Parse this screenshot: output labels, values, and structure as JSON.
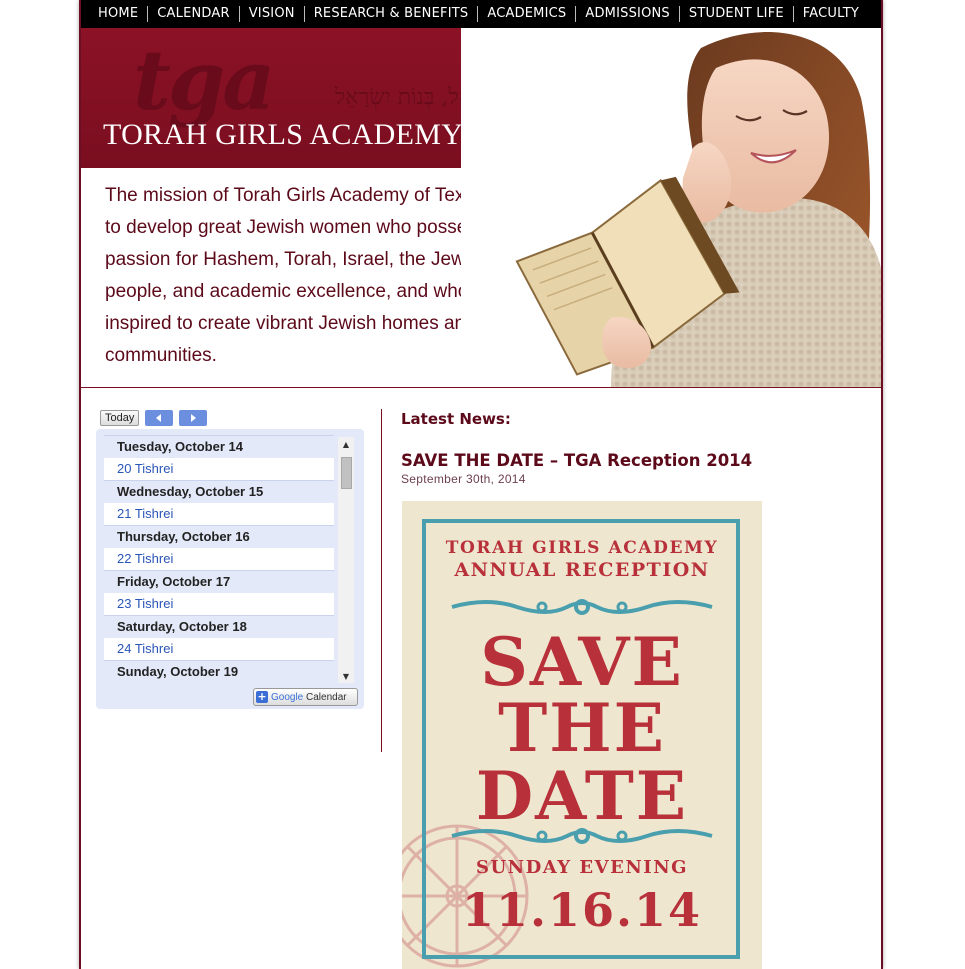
{
  "nav": {
    "items": [
      "HOME",
      "CALENDAR",
      "VISION",
      "RESEARCH & BENEFITS",
      "ACADEMICS",
      "ADMISSIONS",
      "STUDENT LIFE",
      "FACULTY"
    ]
  },
  "header": {
    "logo_text": "tga",
    "hebrew_text": "בְּנוֹת יִשְׂרָאֵל, בְּנוֹת יִשְׂרָאֵל",
    "school_name": "TORAH GIRLS ACADEMY of Texas",
    "mission": "The mission of Torah Girls Academy of Texas is to develop great Jewish women who possess a passion for Hashem, Torah, Israel, the Jewish people, and academic excellence, and who are inspired to create vibrant Jewish homes and communities."
  },
  "calendar": {
    "today_label": "Today",
    "entries": [
      {
        "day": "Tuesday, October 14",
        "event": "20 Tishrei"
      },
      {
        "day": "Wednesday, October 15",
        "event": "21 Tishrei"
      },
      {
        "day": "Thursday, October 16",
        "event": "22 Tishrei"
      },
      {
        "day": "Friday, October 17",
        "event": "23 Tishrei"
      },
      {
        "day": "Saturday, October 18",
        "event": "24 Tishrei"
      },
      {
        "day": "Sunday, October 19",
        "event": ""
      }
    ],
    "google_label_1": "Google",
    "google_label_2": " Calendar"
  },
  "news": {
    "heading": "Latest News:",
    "title": "SAVE THE DATE – TGA Reception 2014",
    "date": "September 30th, 2014",
    "poster": {
      "line1": "TORAH GIRLS ACADEMY",
      "line2": "ANNUAL RECEPTION",
      "big1": "SAVE",
      "big2": "THE",
      "big3": "DATE",
      "when": "SUNDAY EVENING",
      "date": "11.16.14"
    }
  },
  "colors": {
    "maroon": "#7a0e20",
    "poster_red": "#b8303a",
    "poster_teal": "#4a9fae",
    "link_blue": "#2a55b8"
  }
}
